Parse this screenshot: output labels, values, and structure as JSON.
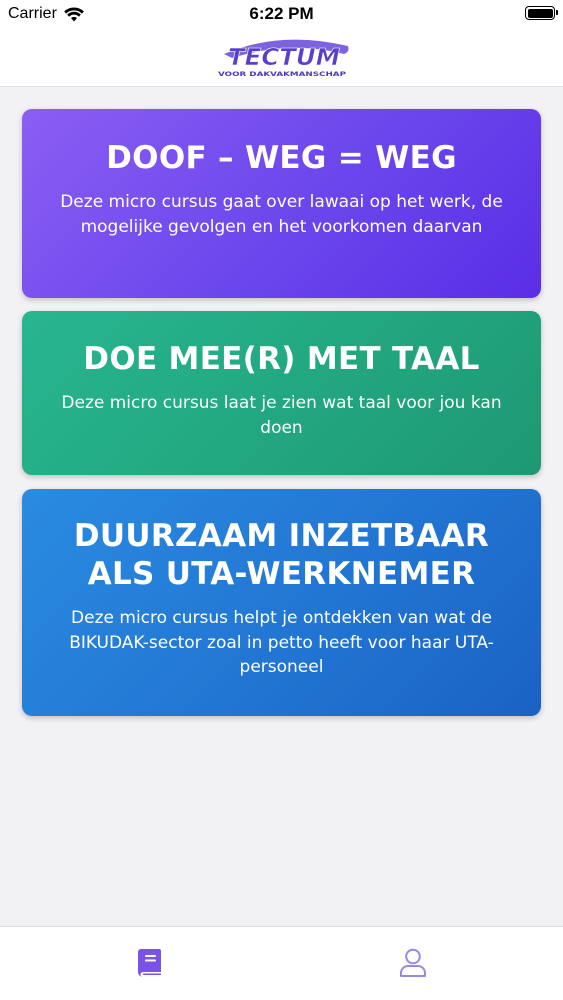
{
  "status_bar": {
    "carrier": "Carrier",
    "time": "6:22 PM"
  },
  "header": {
    "logo_text": "TECTUM",
    "logo_tagline": "VOOR DAKVAKMANSCHAP"
  },
  "courses": [
    {
      "title": "DOOF – WEG = WEG",
      "description": "Deze micro cursus gaat over lawaai op het werk, de mogelijke gevolgen en het voorkomen daarvan",
      "color": "#6b46ec"
    },
    {
      "title": "DOE MEE(R) MET TAAL",
      "description": "Deze micro cursus laat je zien wat taal voor jou kan doen",
      "color": "#22a77f"
    },
    {
      "title": "DUURZAAM INZETBAAR ALS UTA-WERKNEMER",
      "description": "Deze micro cursus helpt je ontdekken van wat de BIKUDAK-sector zoal in petto heeft voor haar UTA-personeel",
      "color": "#2276d3"
    }
  ],
  "tab_bar": {
    "items": [
      {
        "icon": "book-icon",
        "active": true,
        "color": "#7b52e8"
      },
      {
        "icon": "user-icon",
        "active": false,
        "color": "#9a86e6"
      }
    ]
  }
}
